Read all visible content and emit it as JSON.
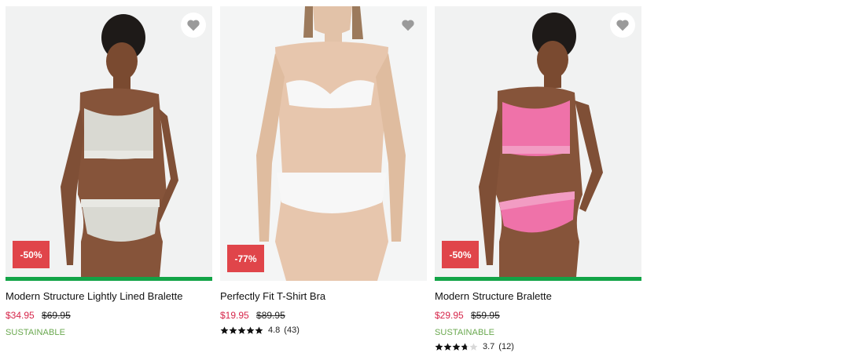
{
  "products": [
    {
      "title": "Modern Structure Lightly Lined Bralette",
      "sale_price": "$34.95",
      "original_price": "$69.95",
      "discount": "-50%",
      "badge": "SUSTAINABLE",
      "garment_color": "#d9d9d2",
      "has_rating": false
    },
    {
      "title": "Perfectly Fit T-Shirt Bra",
      "sale_price": "$19.95",
      "original_price": "$89.95",
      "discount": "-77%",
      "rating_value": "4.8",
      "rating_count": "(43)",
      "stars_filled": 5,
      "garment_color": "#f7f7f7",
      "has_rating": true
    },
    {
      "title": "Modern Structure Bralette",
      "sale_price": "$29.95",
      "original_price": "$59.95",
      "discount": "-50%",
      "badge": "SUSTAINABLE",
      "rating_value": "3.7",
      "rating_count": "(12)",
      "stars_filled": 3.7,
      "garment_color": "#ef72a9",
      "has_rating": true
    }
  ],
  "icons": {
    "favorite": "heart-icon",
    "rating": "star-icon"
  },
  "colors": {
    "sale": "#d6264a",
    "discount_badge": "#e0454a",
    "sustainable": "#6aa84f",
    "availability_bar": "#12a447"
  }
}
